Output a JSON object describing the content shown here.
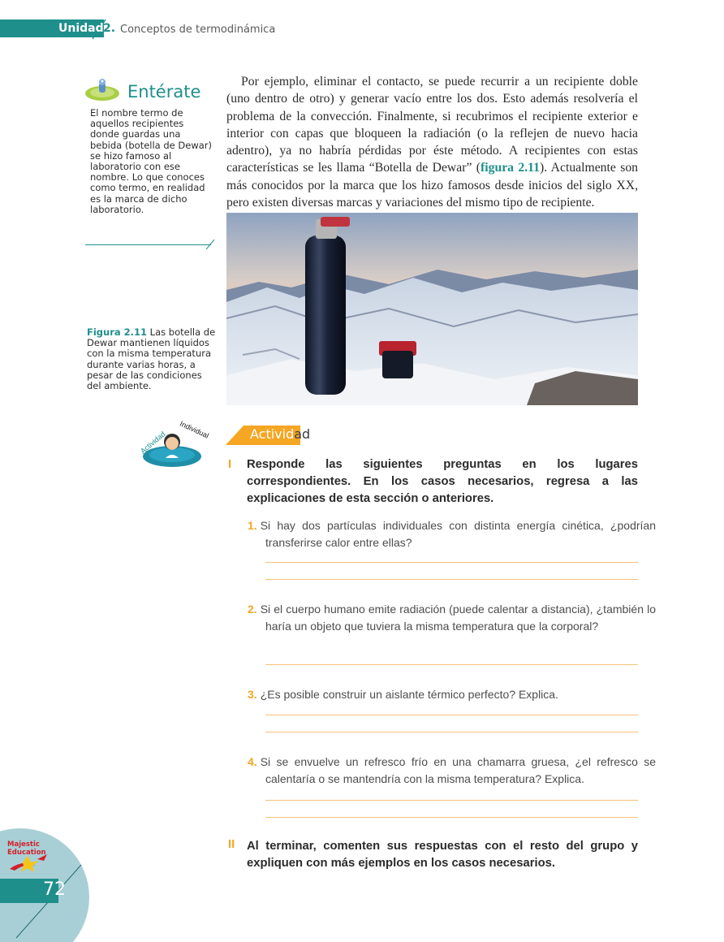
{
  "header": {
    "unit_label": "Unidad",
    "unit_number": "2.",
    "title": "Conceptos de  termodinámica"
  },
  "sidebar": {
    "enterate_title": "Entérate",
    "note": "El nombre termo de aquellos recipientes donde guardas una bebida (botella de Dewar) se hizo famoso al laboratorio con ese nombre. Lo que conoces como termo, en realidad es la marca de dicho laboratorio."
  },
  "main": {
    "intro_before_ref": "Por ejemplo, eliminar el contacto, se puede recurrir a un recipiente doble (uno dentro de otro) y generar vacío entre los dos. Esto además resolvería el problema de la convección. Finalmente, si recubrimos el recipiente exterior e interior con capas que bloqueen la radiación (o la reflejen de nuevo hacia adentro), ya no habría pérdidas por éste método. A recipientes con estas características se les llama “Botella de Dewar” (",
    "intro_ref": "figura 2.11",
    "intro_after_ref": "). Actualmente son más conocidos por la marca que los hizo famosos desde inicios del siglo XX, pero existen diversas marcas y variaciones del mismo tipo de recipiente."
  },
  "figure": {
    "label": "Figura 2.11",
    "caption": " Las botella de Dewar mantienen líquidos con la misma temperatura durante varias horas, a pesar de las condiciones del ambiente."
  },
  "activity": {
    "badge_text_1": "Actividad",
    "badge_text_2": "Individual",
    "title_main": "Activid",
    "title_tail": "ad",
    "section_1_roman": "I",
    "section_1_text": "Responde las siguientes preguntas en los lugares correspondientes. En los casos necesarios, regresa a las explicaciones de esta sección o anteriores.",
    "questions": [
      {
        "num": "1.",
        "text": "Si hay dos partículas individuales con distinta energía cinética, ¿podrían transferirse calor entre ellas?"
      },
      {
        "num": "2.",
        "text": "Si el cuerpo humano emite radiación (puede calentar a distancia), ¿también lo haría un objeto que tuviera la misma temperatura que la corporal?"
      },
      {
        "num": "3.",
        "text": "¿Es posible construir un aislante térmico perfecto? Explica."
      },
      {
        "num": "4.",
        "text": "Si se envuelve un refresco frío en una chamarra gruesa, ¿el refresco se calentaría o se mantendría con la misma temperatura? Explica."
      }
    ],
    "section_2_roman": "II",
    "section_2_text": "Al terminar, comenten sus respuestas con el resto del grupo y expliquen con más ejemplos en los casos necesarios."
  },
  "footer": {
    "page_number": "72",
    "logo_line1": "Majestic",
    "logo_line2": "Education"
  },
  "colors": {
    "teal": "#1f8f8c",
    "orange": "#f5a623",
    "answer_line": "#f4c27a"
  }
}
